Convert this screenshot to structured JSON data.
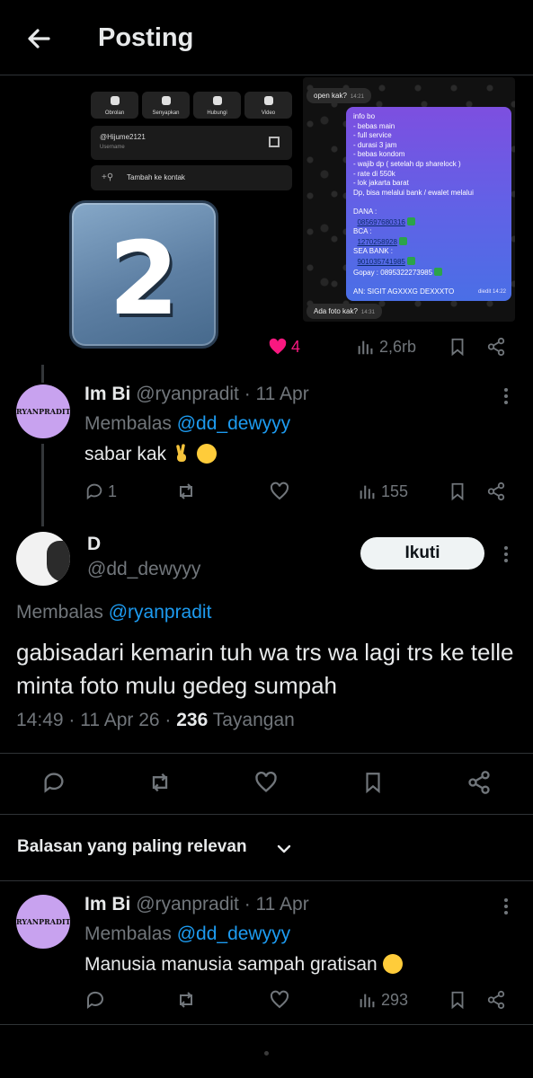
{
  "header": {
    "title": "Posting"
  },
  "media": {
    "left_shot": {
      "actions": [
        "Obrolan",
        "Senyapkan",
        "Hubungi",
        "Video"
      ],
      "username": "@Hijume2121",
      "username_caption": "Username",
      "add_contact": "Tambah ke kontak",
      "number_overlay": "2"
    },
    "right_shot": {
      "msg_top": "open kak?",
      "msg_top_time": "14:21",
      "lines": [
        "info bo",
        "- bebas main",
        "- full service",
        "- durasi 3 jam",
        "- bebas kondom",
        "- wajib dp ( setelah dp sharelock )",
        "- rate di 550k",
        "- lok jakarta barat",
        "Dp, bisa melalui bank / ewalet melalui",
        "",
        "DANA :",
        "085697680316",
        "BCA :",
        "1270258928",
        "SEA BANK :",
        "901035741985",
        "Gopay : 0895322273985",
        "",
        "AN: SIGIT AGXXXG DEXXXTO"
      ],
      "msg_meta": "diedit 14:22",
      "msg_bottom": "Ada foto kak?",
      "msg_bottom_time": "14:31"
    }
  },
  "parent_actions": {
    "likes": "4",
    "views": "2,6rb"
  },
  "reply1": {
    "name": "Im Bi",
    "handle": "@ryanpradit",
    "date": "· 11 Apr",
    "replying_prefix": "Membalas",
    "replying_to": "@dd_dewyyy",
    "text": "sabar kak",
    "avatar_text": "RYANPRADIT",
    "replies": "1",
    "views": "155"
  },
  "focus": {
    "name": "D",
    "handle": "@dd_dewyyy",
    "follow_label": "Ikuti",
    "replying_prefix": "Membalas",
    "replying_to": "@ryanpradit",
    "text": "gabisadari kemarin tuh wa trs wa lagi trs ke telle minta foto mulu gedeg sumpah",
    "time": "14:49 · 11 Apr 26 ·",
    "views_count": "236",
    "views_label": "Tayangan"
  },
  "sort": {
    "label": "Balasan yang paling relevan"
  },
  "reply2": {
    "name": "Im Bi",
    "handle": "@ryanpradit",
    "date": "· 11 Apr",
    "replying_prefix": "Membalas",
    "replying_to": "@dd_dewyyy",
    "text": "Manusia manusia sampah gratisan",
    "avatar_text": "RYANPRADIT",
    "views": "293"
  },
  "colors": {
    "accent": "#1d9bf0",
    "like": "#f91880",
    "muted": "#71767b",
    "avatar": "#c8a2ef"
  }
}
